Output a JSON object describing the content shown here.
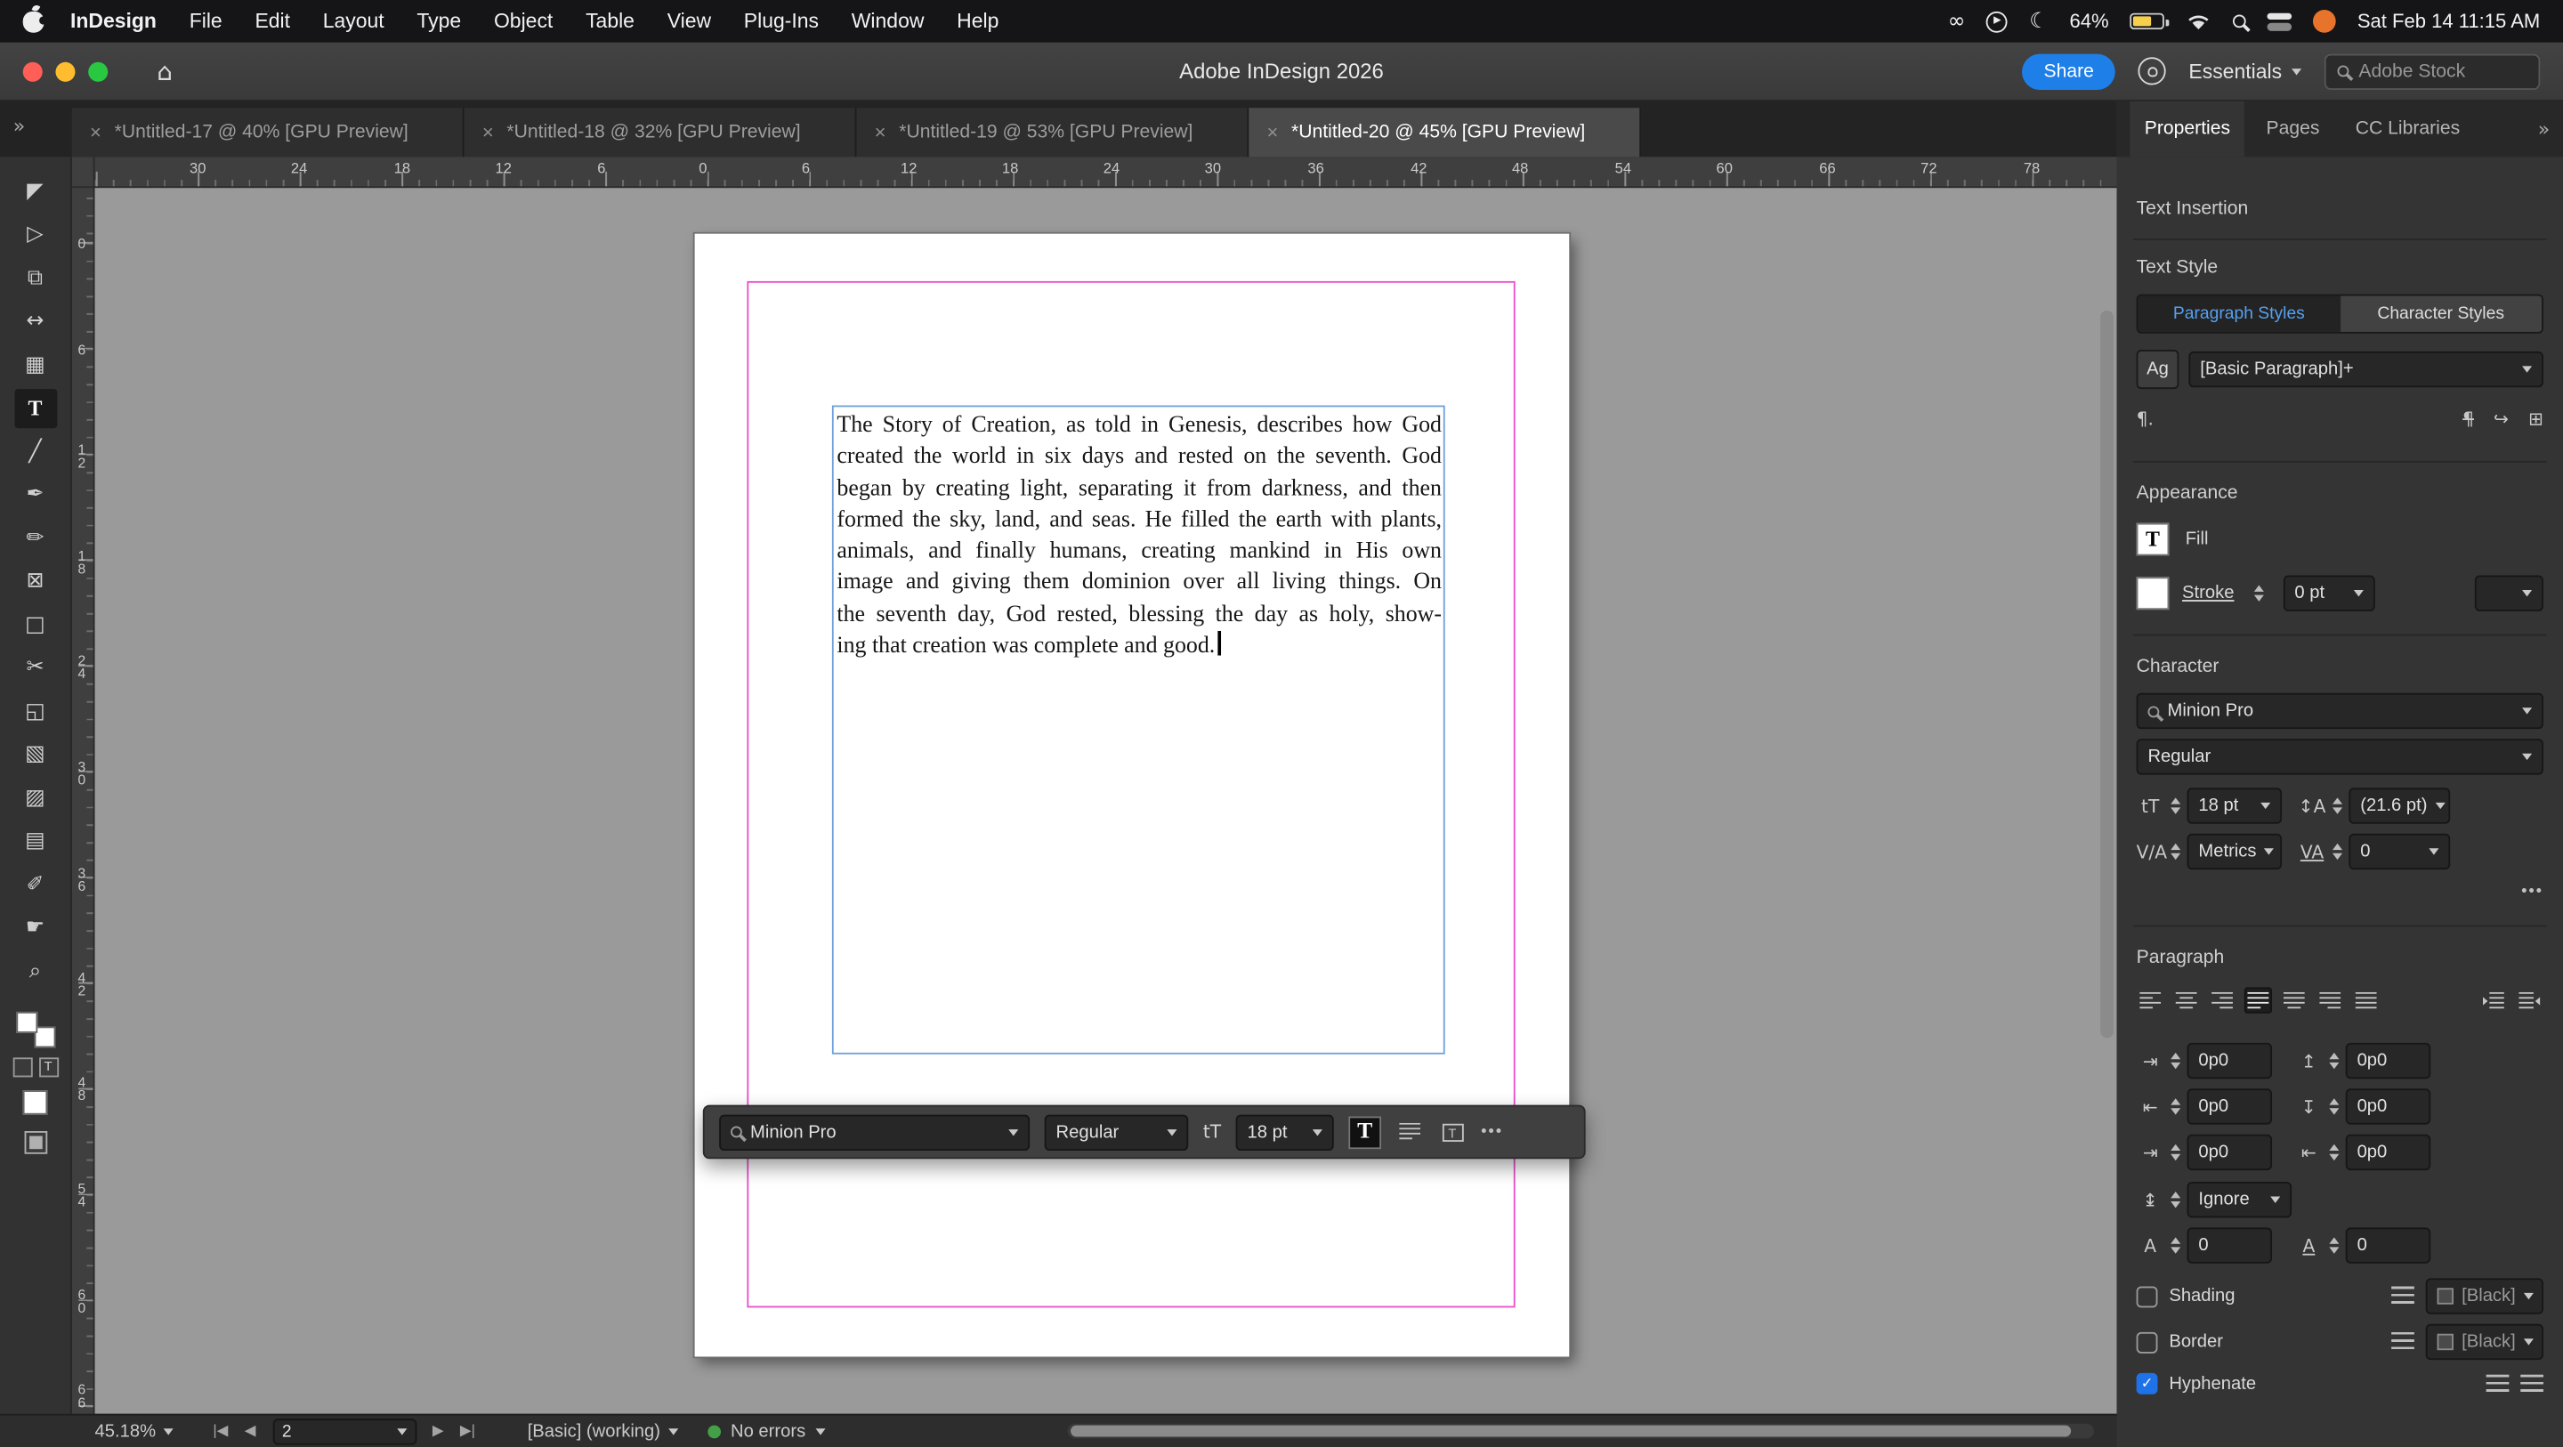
{
  "colors": {
    "accent": "#1473e6",
    "margin_guide": "#e94fce",
    "frame_edge": "#6fa0dc",
    "no_errors_green": "#43a047",
    "battery_fill": "#f6d04d"
  },
  "menubar": {
    "app_name": "InDesign",
    "menus": [
      "File",
      "Edit",
      "Layout",
      "Type",
      "Object",
      "Table",
      "View",
      "Plug-Ins",
      "Window",
      "Help"
    ],
    "battery_percent": "64%",
    "clock": "Sat Feb 14 11:15 AM"
  },
  "titlebar": {
    "title": "Adobe InDesign 2026",
    "share_label": "Share",
    "workspace_label": "Essentials",
    "stock_search_placeholder": "Adobe Stock"
  },
  "tabbar": {
    "tabs": [
      {
        "label": "*Untitled-17 @ 40% [GPU Preview]"
      },
      {
        "label": "*Untitled-18 @ 32% [GPU Preview]"
      },
      {
        "label": "*Untitled-19 @ 53% [GPU Preview]"
      },
      {
        "label": "*Untitled-20 @ 45% [GPU Preview]"
      }
    ]
  },
  "panel_tabs": {
    "properties": "Properties",
    "pages": "Pages",
    "cc_libraries": "CC Libraries"
  },
  "rulers": {
    "horizontal": [
      "30",
      "24",
      "18",
      "12",
      "6",
      "0",
      "6",
      "12",
      "18",
      "24",
      "30",
      "36",
      "42",
      "48",
      "54",
      "60",
      "66",
      "72",
      "78"
    ],
    "vertical": [
      "0",
      "6",
      "12",
      "18",
      "24",
      "30",
      "36",
      "42",
      "48",
      "54",
      "60",
      "66"
    ]
  },
  "tools": [
    {
      "name": "selection",
      "glyph": "◤"
    },
    {
      "name": "direct-selection",
      "glyph": "▷"
    },
    {
      "name": "page",
      "glyph": "⧉"
    },
    {
      "name": "gap",
      "glyph": "↔"
    },
    {
      "name": "content-collector",
      "glyph": "▦"
    },
    {
      "name": "type",
      "glyph": "T"
    },
    {
      "name": "line",
      "glyph": "╱"
    },
    {
      "name": "pen",
      "glyph": "✒"
    },
    {
      "name": "pencil",
      "glyph": "✏"
    },
    {
      "name": "rectangle-frame",
      "glyph": "⊠"
    },
    {
      "name": "rectangle",
      "glyph": "□"
    },
    {
      "name": "scissors",
      "glyph": "✂"
    },
    {
      "name": "free-transform",
      "glyph": "◱"
    },
    {
      "name": "gradient",
      "glyph": "▧"
    },
    {
      "name": "gradient-feather",
      "glyph": "▨"
    },
    {
      "name": "note",
      "glyph": "▤"
    },
    {
      "name": "eyedropper",
      "glyph": "✐"
    },
    {
      "name": "hand",
      "glyph": "☛"
    },
    {
      "name": "zoom",
      "glyph": "⌕"
    }
  ],
  "document": {
    "text_lines": [
      "The Story of Creation, as told in Genesis, describes how God",
      "created the world in six days and rested on the seventh. God",
      "began by creating light, separating it from darkness, and then",
      "formed the sky, land, and seas. He filled the earth with plants,",
      "animals, and finally humans, creating mankind in His own",
      "image and giving them dominion over all living things. On",
      "the seventh day, God rested, blessing the day as holy, show-",
      "ing that creation was complete and good."
    ]
  },
  "floating_toolbar": {
    "font_name": "Minion Pro",
    "font_style": "Regular",
    "size": "18 pt",
    "more": "•••"
  },
  "panel": {
    "headings": {
      "text_insertion": "Text Insertion",
      "text_style": "Text Style",
      "appearance": "Appearance",
      "character": "Character",
      "paragraph": "Paragraph"
    },
    "text_style": {
      "paragraph_styles": "Paragraph Styles",
      "character_styles": "Character Styles",
      "ag": "Ag",
      "style_name": "[Basic Paragraph]+"
    },
    "appearance": {
      "fill": "Fill",
      "stroke": "Stroke",
      "stroke_weight": "0 pt"
    },
    "character": {
      "font_name": "Minion Pro",
      "font_style": "Regular",
      "size": "18 pt",
      "leading": "(21.6 pt)",
      "kerning": "Metrics",
      "tracking": "0",
      "more": "•••"
    },
    "paragraph": {
      "left_indent": "0p0",
      "space_before": "0p0",
      "right_indent": "0p0",
      "space_after": "0p0",
      "first_line_indent": "0p0",
      "last_line_indent": "0p0",
      "same_style_spacing": "Ignore",
      "drop_cap_lines": "0",
      "drop_cap_chars": "0",
      "shading": "Shading",
      "shading_swatch": "[Black]",
      "border": "Border",
      "border_swatch": "[Black]",
      "hyphenate": "Hyphenate"
    }
  },
  "statusbar": {
    "zoom": "45.18%",
    "page": "2",
    "preflight_profile": "[Basic] (working)",
    "errors": "No errors"
  },
  "icons": {
    "home": "⌂",
    "infinity": "∞",
    "play": "▶",
    "moon": "☾",
    "expand": "»",
    "paragraph_mark": "¶.",
    "clear_overrides": "¶",
    "redefine": "↪",
    "new_style": "⊞",
    "check": "✓",
    "size": "tT",
    "leading": "↕A",
    "kerning": "V∕A",
    "tracking": "VA",
    "indent_left": "⇥",
    "indent_right": "⇤",
    "space_before": "↥",
    "space_after": "↧",
    "indent_first": "⇥",
    "indent_last": "⇤",
    "same_style": "↨",
    "drop_cap": "A",
    "drop_chars": "A",
    "first_page": "|◀",
    "prev_page": "◀",
    "next_page": "▶",
    "last_page": "▶|"
  }
}
